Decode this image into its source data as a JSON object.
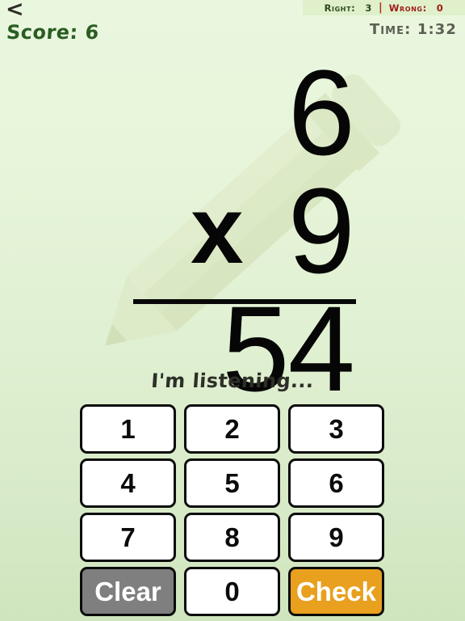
{
  "header": {
    "back_icon": "chevron-left-icon",
    "back_label": "<",
    "score_label": "Score: 6",
    "timer_label": "Time: 1:32",
    "stats": {
      "right_label": "Right:",
      "right_value": "3",
      "separator": "|",
      "wrong_label": "Wrong:",
      "wrong_value": "0"
    }
  },
  "problem": {
    "operand_a": "6",
    "operator": "x",
    "operand_b": "9",
    "result": "54"
  },
  "status": {
    "listening_label": "I'm listening..."
  },
  "keypad": {
    "keys": [
      {
        "label": "1",
        "kind": "digit"
      },
      {
        "label": "2",
        "kind": "digit"
      },
      {
        "label": "3",
        "kind": "digit"
      },
      {
        "label": "4",
        "kind": "digit"
      },
      {
        "label": "5",
        "kind": "digit"
      },
      {
        "label": "6",
        "kind": "digit"
      },
      {
        "label": "7",
        "kind": "digit"
      },
      {
        "label": "8",
        "kind": "digit"
      },
      {
        "label": "9",
        "kind": "digit"
      },
      {
        "label": "Clear",
        "kind": "clear"
      },
      {
        "label": "0",
        "kind": "digit"
      },
      {
        "label": "Check",
        "kind": "check"
      }
    ]
  },
  "colors": {
    "background_top": "#eaf7df",
    "background_bottom": "#cfe5bd",
    "stats_band": "#dff0cb",
    "right_text": "#2d4a20",
    "wrong_text": "#9e1b16",
    "score_text": "#2a5d22",
    "timer_text": "#5b5f54",
    "clear_button": "#7f7f7f",
    "check_button": "#e8a01e",
    "key_background": "#ffffff",
    "key_border": "#0b0b0b",
    "problem_text": "#060606",
    "watermark": "#d7e3bc"
  }
}
